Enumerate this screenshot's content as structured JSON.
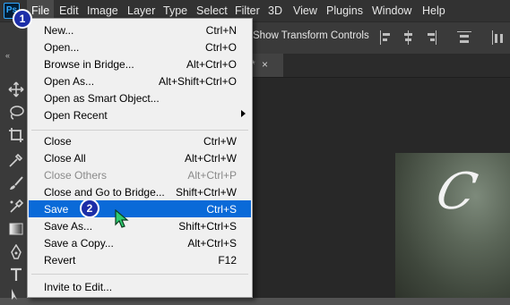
{
  "app": {
    "logo": "Ps"
  },
  "menubar": [
    {
      "label": "File"
    },
    {
      "label": "Edit"
    },
    {
      "label": "Image"
    },
    {
      "label": "Layer"
    },
    {
      "label": "Type"
    },
    {
      "label": "Select"
    },
    {
      "label": "Filter"
    },
    {
      "label": "3D"
    },
    {
      "label": "View"
    },
    {
      "label": "Plugins"
    },
    {
      "label": "Window"
    },
    {
      "label": "Help"
    }
  ],
  "options_bar": {
    "show_transform_label": "Show Transform Controls"
  },
  "doc_tab": {
    "modified": "*",
    "close": "×"
  },
  "toolbar": {
    "collapse": "«"
  },
  "canvas": {
    "script_text": "C"
  },
  "file_menu": {
    "items": [
      {
        "label": "New...",
        "shortcut": "Ctrl+N"
      },
      {
        "label": "Open...",
        "shortcut": "Ctrl+O"
      },
      {
        "label": "Browse in Bridge...",
        "shortcut": "Alt+Ctrl+O"
      },
      {
        "label": "Open As...",
        "shortcut": "Alt+Shift+Ctrl+O"
      },
      {
        "label": "Open as Smart Object...",
        "shortcut": ""
      },
      {
        "label": "Open Recent",
        "shortcut": ""
      },
      {
        "label": "Close",
        "shortcut": "Ctrl+W"
      },
      {
        "label": "Close All",
        "shortcut": "Alt+Ctrl+W"
      },
      {
        "label": "Close Others",
        "shortcut": "Alt+Ctrl+P"
      },
      {
        "label": "Close and Go to Bridge...",
        "shortcut": "Shift+Ctrl+W"
      },
      {
        "label": "Save",
        "shortcut": "Ctrl+S"
      },
      {
        "label": "Save As...",
        "shortcut": "Shift+Ctrl+S"
      },
      {
        "label": "Save a Copy...",
        "shortcut": "Alt+Ctrl+S"
      },
      {
        "label": "Revert",
        "shortcut": "F12"
      },
      {
        "label": "Invite to Edit...",
        "shortcut": ""
      }
    ]
  },
  "badges": {
    "step1": "1",
    "step2": "2"
  },
  "colors": {
    "highlight": "#0a6ad8",
    "badge": "#1d2fa8",
    "cursor": "#2ecc71"
  }
}
